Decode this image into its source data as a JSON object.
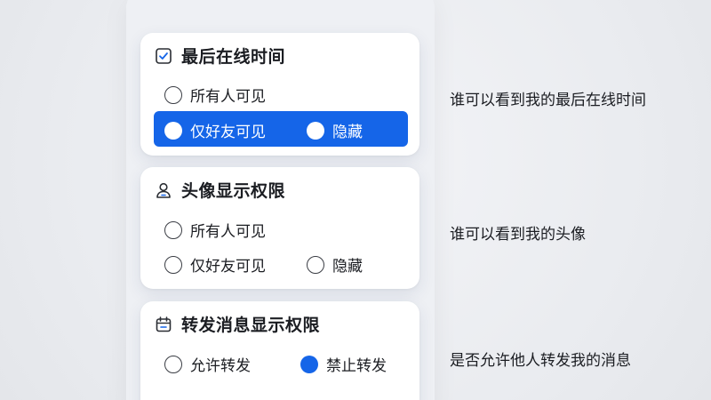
{
  "sections": [
    {
      "title": "最后在线时间",
      "icon": "checkbox-icon",
      "options": [
        "所有人可见",
        "仅好友可见",
        "隐藏"
      ],
      "selected": "仅好友可见",
      "description": "谁可以看到我的最后在线时间"
    },
    {
      "title": "头像显示权限",
      "icon": "user-icon",
      "options": [
        "所有人可见",
        "仅好友可见",
        "隐藏"
      ],
      "selected": null,
      "description": "谁可以看到我的头像"
    },
    {
      "title": "转发消息显示权限",
      "icon": "calendar-icon",
      "options": [
        "允许转发",
        "禁止转发"
      ],
      "selected": "禁止转发",
      "description": "是否允许他人转发我的消息"
    }
  ],
  "colors": {
    "accent": "#1565e8",
    "text": "#1b1d22",
    "card": "#ffffff",
    "background": "#eef0f3"
  }
}
